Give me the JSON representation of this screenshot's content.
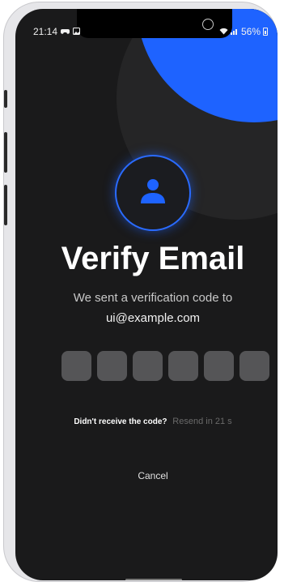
{
  "status_bar": {
    "time": "21:14",
    "battery_label": "56%"
  },
  "title": "Verify Email",
  "subtitle": "We sent a verification code to",
  "email": "ui@example.com",
  "otp_length": 6,
  "resend": {
    "question": "Didn't receive the code?",
    "timer": "Resend in 21 s"
  },
  "cancel_label": "Cancel",
  "colors": {
    "accent": "#1e63ff",
    "background": "#1a1a1b",
    "otp_box": "#555557"
  },
  "icons": {
    "avatar": "user-icon",
    "status_left": [
      "game-controller-icon",
      "image-icon"
    ],
    "status_right": [
      "wifi-icon",
      "signal-icon",
      "battery-icon"
    ]
  }
}
